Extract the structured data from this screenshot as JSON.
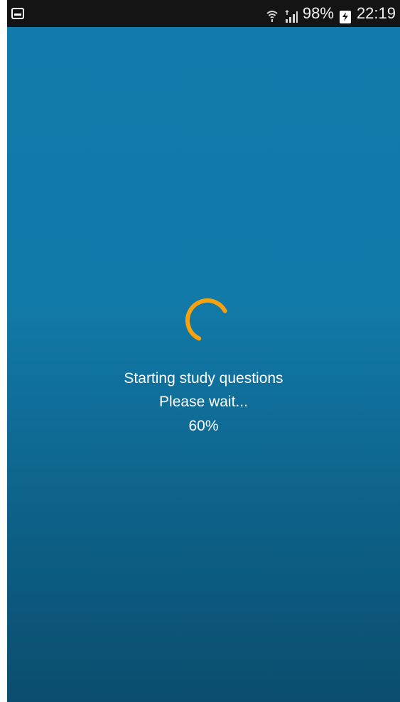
{
  "status_bar": {
    "left_icon": "screenshot-notification-icon",
    "wifi_icon": "wifi-icon",
    "signal_icon": "signal-icon",
    "battery_percent": "98%",
    "battery_icon": "battery-charging-icon",
    "time": "22:19"
  },
  "loading": {
    "title": "Starting study questions",
    "subtitle": "Please wait...",
    "progress_text": "60%",
    "progress_value": 0.6
  },
  "colors": {
    "status_bar": "#141414",
    "background_top": "#137bab",
    "background_bottom": "#0b4d6d",
    "spinner": "#f6a20f",
    "text": "#ffffff"
  }
}
